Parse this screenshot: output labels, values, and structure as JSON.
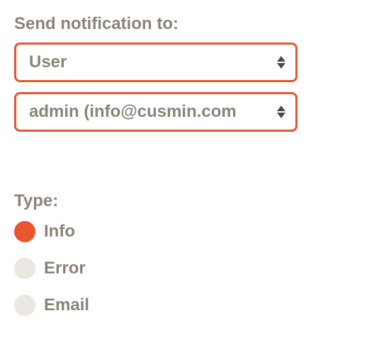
{
  "notification": {
    "label": "Send notification to:",
    "recipient_type": {
      "selected": "User"
    },
    "recipient": {
      "selected": "admin (info@cusmin.com"
    }
  },
  "type": {
    "label": "Type:",
    "options": [
      {
        "label": "Info",
        "selected": true
      },
      {
        "label": "Error",
        "selected": false
      },
      {
        "label": "Email",
        "selected": false
      }
    ]
  }
}
